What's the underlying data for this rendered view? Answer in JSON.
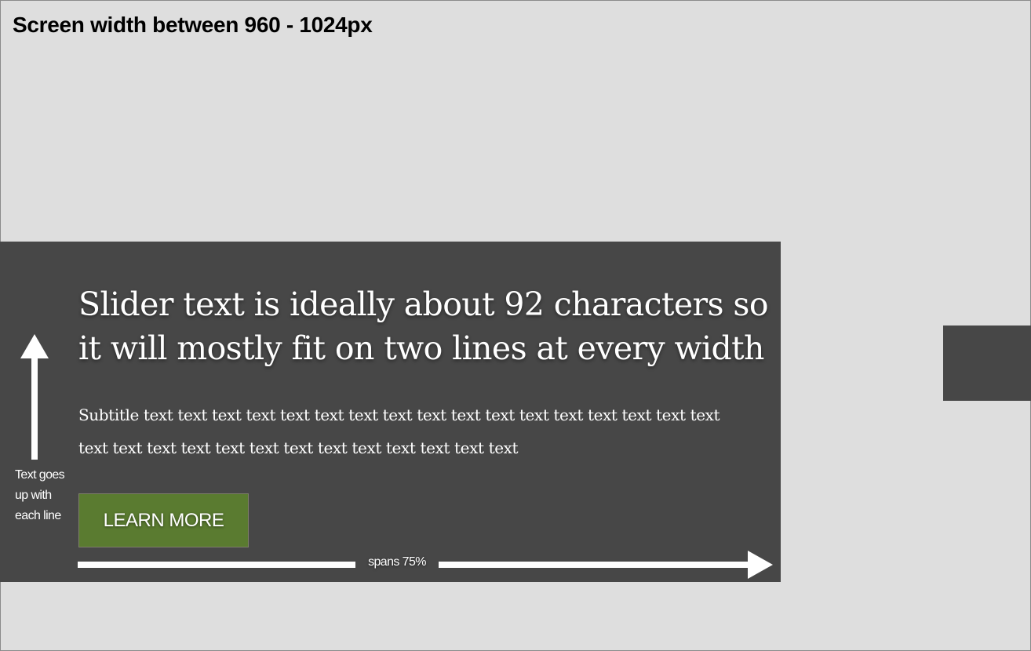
{
  "page": {
    "screen_label": "Screen width between 960 - 1024px"
  },
  "slider": {
    "headline": "Slider text is ideally about 92 characters so it will mostly fit on two lines at every width",
    "subtitle": "Subtitle text text text text text text text text text text text text text text text text text text text text text text text text text text text text text text",
    "cta_label": "LEARN MORE",
    "annotations": {
      "up_caption": "Text goes up with each line",
      "span_caption": "spans 75%"
    }
  },
  "colors": {
    "background": "#dedede",
    "slider_bg": "#474747",
    "cta_bg": "#5a7b30",
    "text": "#ffffff"
  },
  "icons": {
    "up_arrow": "arrow-up-icon",
    "span_arrow": "arrow-right-icon"
  }
}
